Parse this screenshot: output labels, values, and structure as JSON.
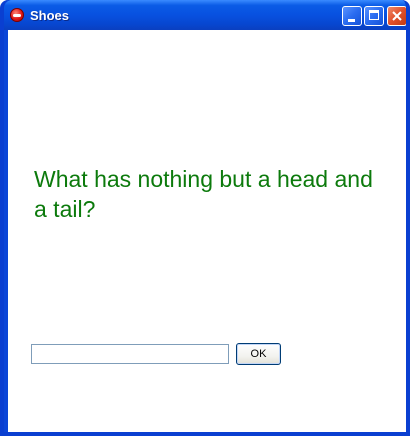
{
  "window": {
    "title": "Shoes",
    "app_icon": "shoes-logo-icon",
    "controls": {
      "minimize_icon": "minimize-icon",
      "maximize_icon": "maximize-icon",
      "close_icon": "close-icon"
    }
  },
  "main": {
    "question": "What has nothing but a head and a tail?",
    "answer_input": {
      "value": "",
      "placeholder": ""
    },
    "ok_label": "OK"
  },
  "colors": {
    "question_text": "#0c7a0c",
    "titlebar": "#0851e0"
  }
}
